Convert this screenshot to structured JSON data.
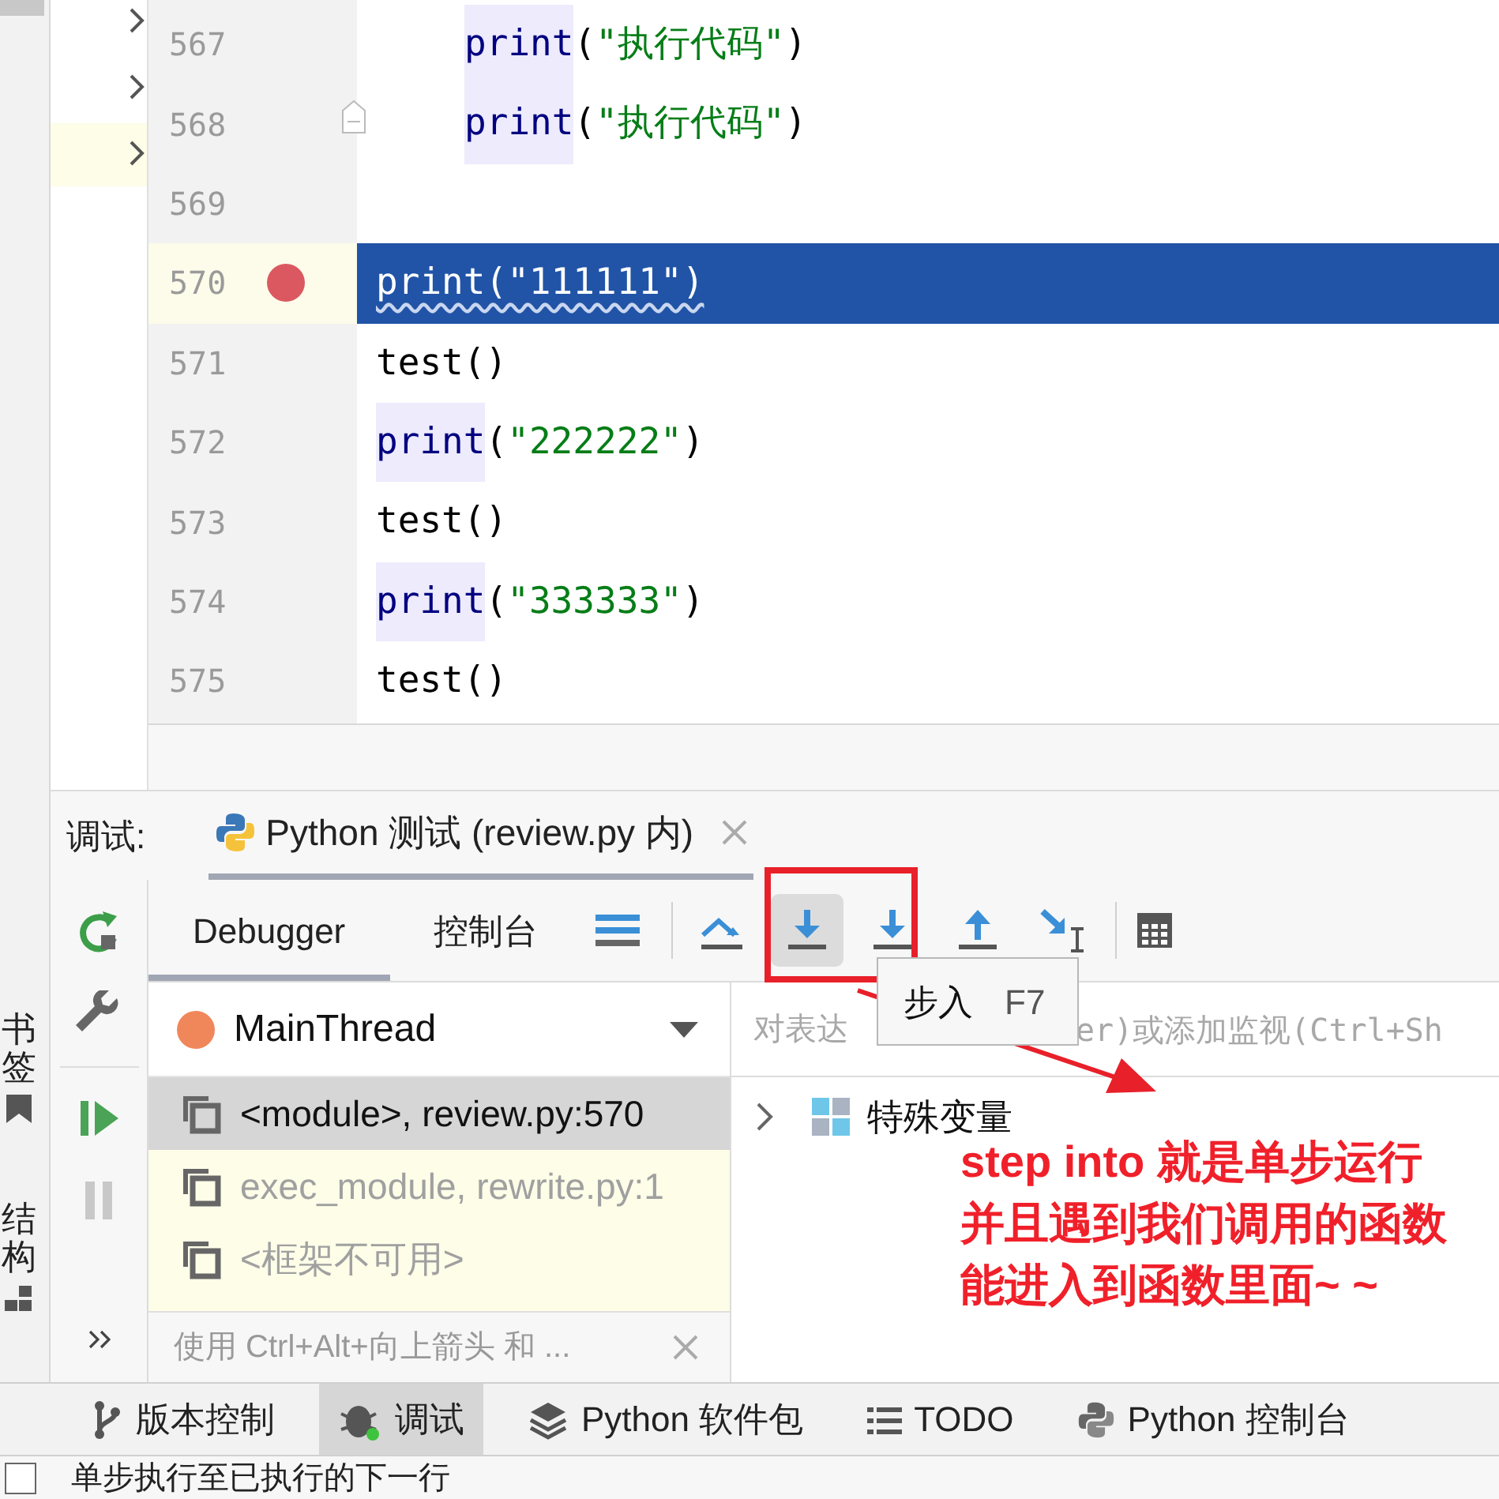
{
  "left_stripe": {
    "items": [
      {
        "label": "书签",
        "kind": "bookmark"
      },
      {
        "label": "结构",
        "kind": "structure"
      }
    ]
  },
  "editor": {
    "lines": [
      {
        "number": "567",
        "indented": true,
        "current": false,
        "breakpoint": false,
        "fold": false,
        "tokens": [
          {
            "text": "print",
            "kind": "builtin"
          },
          {
            "text": "(",
            "kind": "plain"
          },
          {
            "text": "\"执行代码\"",
            "kind": "string"
          },
          {
            "text": ")",
            "kind": "plain"
          }
        ]
      },
      {
        "number": "568",
        "indented": true,
        "current": false,
        "breakpoint": false,
        "fold": true,
        "tokens": [
          {
            "text": "print",
            "kind": "builtin"
          },
          {
            "text": "(",
            "kind": "plain"
          },
          {
            "text": "\"执行代码\"",
            "kind": "string"
          },
          {
            "text": ")",
            "kind": "plain"
          }
        ]
      },
      {
        "number": "569",
        "current": false,
        "breakpoint": false,
        "fold": false
      },
      {
        "number": "570",
        "indented": false,
        "current": true,
        "breakpoint": true,
        "fold": false,
        "tokens": [
          {
            "text": "print(\"111111\")",
            "kind": "plain"
          }
        ]
      },
      {
        "number": "571",
        "indented": false,
        "current": false,
        "breakpoint": false,
        "fold": false,
        "tokens": [
          {
            "text": "test()",
            "kind": "plain"
          }
        ]
      },
      {
        "number": "572",
        "indented": false,
        "current": false,
        "breakpoint": false,
        "fold": false,
        "tokens": [
          {
            "text": "print",
            "kind": "builtin"
          },
          {
            "text": "(",
            "kind": "plain"
          },
          {
            "text": "\"222222\"",
            "kind": "string"
          },
          {
            "text": ")",
            "kind": "plain"
          }
        ]
      },
      {
        "number": "573",
        "indented": false,
        "current": false,
        "breakpoint": false,
        "fold": false,
        "tokens": [
          {
            "text": "test()",
            "kind": "plain"
          }
        ]
      },
      {
        "number": "574",
        "indented": false,
        "current": false,
        "breakpoint": false,
        "fold": false,
        "tokens": [
          {
            "text": "print",
            "kind": "builtin"
          },
          {
            "text": "(",
            "kind": "plain"
          },
          {
            "text": "\"333333\"",
            "kind": "string"
          },
          {
            "text": ")",
            "kind": "plain"
          }
        ]
      },
      {
        "number": "575",
        "indented": false,
        "current": false,
        "breakpoint": false,
        "fold": false,
        "tokens": [
          {
            "text": "test()",
            "kind": "plain"
          }
        ]
      }
    ]
  },
  "debug": {
    "title": "调试:",
    "session_tab": {
      "label": "Python 测试 (review.py 内)",
      "selected": true
    },
    "tabs": [
      {
        "label": "Debugger",
        "selected": true
      },
      {
        "label": "控制台",
        "selected": false
      }
    ],
    "step_buttons": [
      {
        "kind": "step-over",
        "hovered": false
      },
      {
        "kind": "step-into",
        "hovered": true
      },
      {
        "kind": "step-into-my-code",
        "hovered": false
      },
      {
        "kind": "step-out",
        "hovered": false
      },
      {
        "kind": "run-to-cursor",
        "hovered": false
      }
    ],
    "tooltip": {
      "label": "步入",
      "shortcut": "F7"
    },
    "thread": "MainThread",
    "frames": [
      {
        "label": "<module>, review.py:570",
        "selected": true,
        "dimmed": false
      },
      {
        "label": "exec_module, rewrite.py:1",
        "selected": false,
        "dimmed": true
      },
      {
        "label": "<框架不可用>",
        "selected": false,
        "dimmed": true
      }
    ],
    "hint": "使用 Ctrl+Alt+向上箭头 和 ...",
    "watch": {
      "placeholder_start": "对表达",
      "placeholder_end": "er)或添加监视(Ctrl+Sh"
    },
    "variables": [
      {
        "label": "特殊变量",
        "expanded": false
      }
    ]
  },
  "tool_tabs": [
    {
      "label": "版本控制",
      "kind": "vcs",
      "selected": false
    },
    {
      "label": "调试",
      "kind": "debug",
      "selected": true
    },
    {
      "label": "Python 软件包",
      "kind": "packages",
      "selected": false
    },
    {
      "label": "TODO",
      "kind": "todo",
      "selected": false
    },
    {
      "label": "Python 控制台",
      "kind": "python",
      "selected": false
    }
  ],
  "status": {
    "checked": false,
    "text": "单步执行至已执行的下一行"
  },
  "annotation": {
    "lines": [
      "step into 就是单步运行",
      "并且遇到我们调用的函数",
      "能进入到函数里面~ ~"
    ]
  }
}
